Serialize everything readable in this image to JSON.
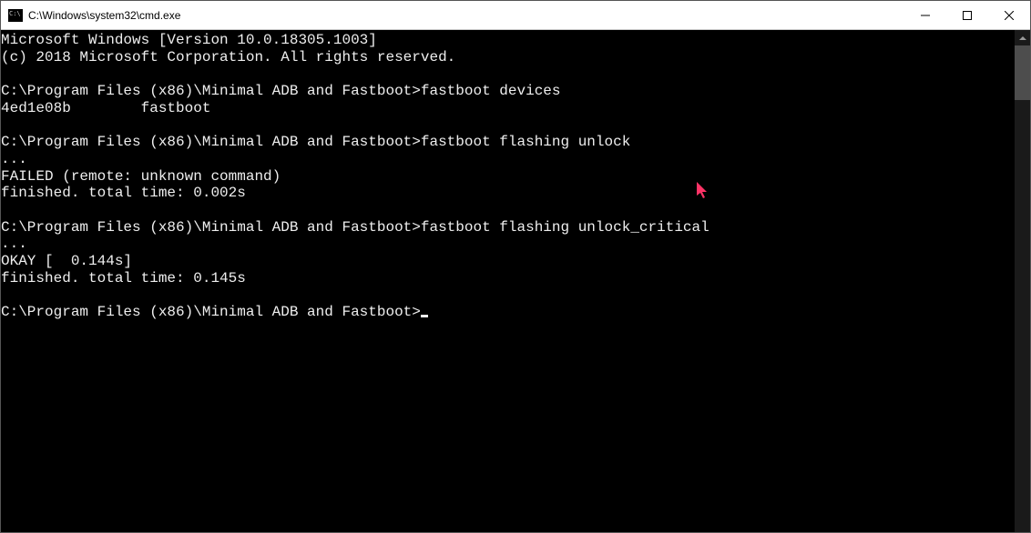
{
  "window": {
    "title": "C:\\Windows\\system32\\cmd.exe"
  },
  "terminal": {
    "lines": [
      "Microsoft Windows [Version 10.0.18305.1003]",
      "(c) 2018 Microsoft Corporation. All rights reserved.",
      "",
      "C:\\Program Files (x86)\\Minimal ADB and Fastboot>fastboot devices",
      "4ed1e08b        fastboot",
      "",
      "C:\\Program Files (x86)\\Minimal ADB and Fastboot>fastboot flashing unlock",
      "...",
      "FAILED (remote: unknown command)",
      "finished. total time: 0.002s",
      "",
      "C:\\Program Files (x86)\\Minimal ADB and Fastboot>fastboot flashing unlock_critical",
      "...",
      "OKAY [  0.144s]",
      "finished. total time: 0.145s",
      "",
      "C:\\Program Files (x86)\\Minimal ADB and Fastboot>"
    ]
  }
}
